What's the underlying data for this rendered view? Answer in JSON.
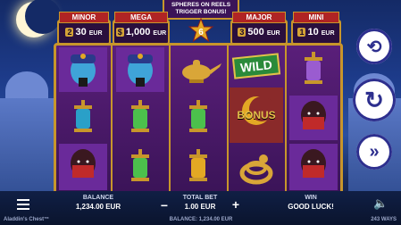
{
  "trigger_text": [
    "SPHERES ON REELS",
    "TRIGGER BONUS!"
  ],
  "counter": "6",
  "jackpots": [
    {
      "title": "MINOR",
      "value": "30",
      "badge": "2",
      "currency": "EUR"
    },
    {
      "title": "MEGA",
      "value": "1,000",
      "badge": "$",
      "currency": "EUR"
    },
    {
      "title": "MAJOR",
      "value": "500",
      "badge": "3",
      "currency": "EUR"
    },
    {
      "title": "MINI",
      "value": "10",
      "badge": "1",
      "currency": "EUR"
    }
  ],
  "symbols": {
    "wild": "WILD",
    "bonus": "BONUS"
  },
  "bottom": {
    "balance_label": "BALANCE",
    "balance_value": "1,234.00 EUR",
    "minus": "−",
    "bet_label": "TOTAL BET",
    "bet_value": "1.00 EUR",
    "plus": "+",
    "win_label": "WIN",
    "win_value": "GOOD LUCK!",
    "game_title": "Aladdin's Chest™",
    "footer_balance": "BALANCE: 1,234.00 EUR",
    "ways": "243 WAYS"
  },
  "colors": {
    "gold": "#c8962b",
    "jackpot_title": "#b02424",
    "reel_bg": "#5a1f7a"
  }
}
